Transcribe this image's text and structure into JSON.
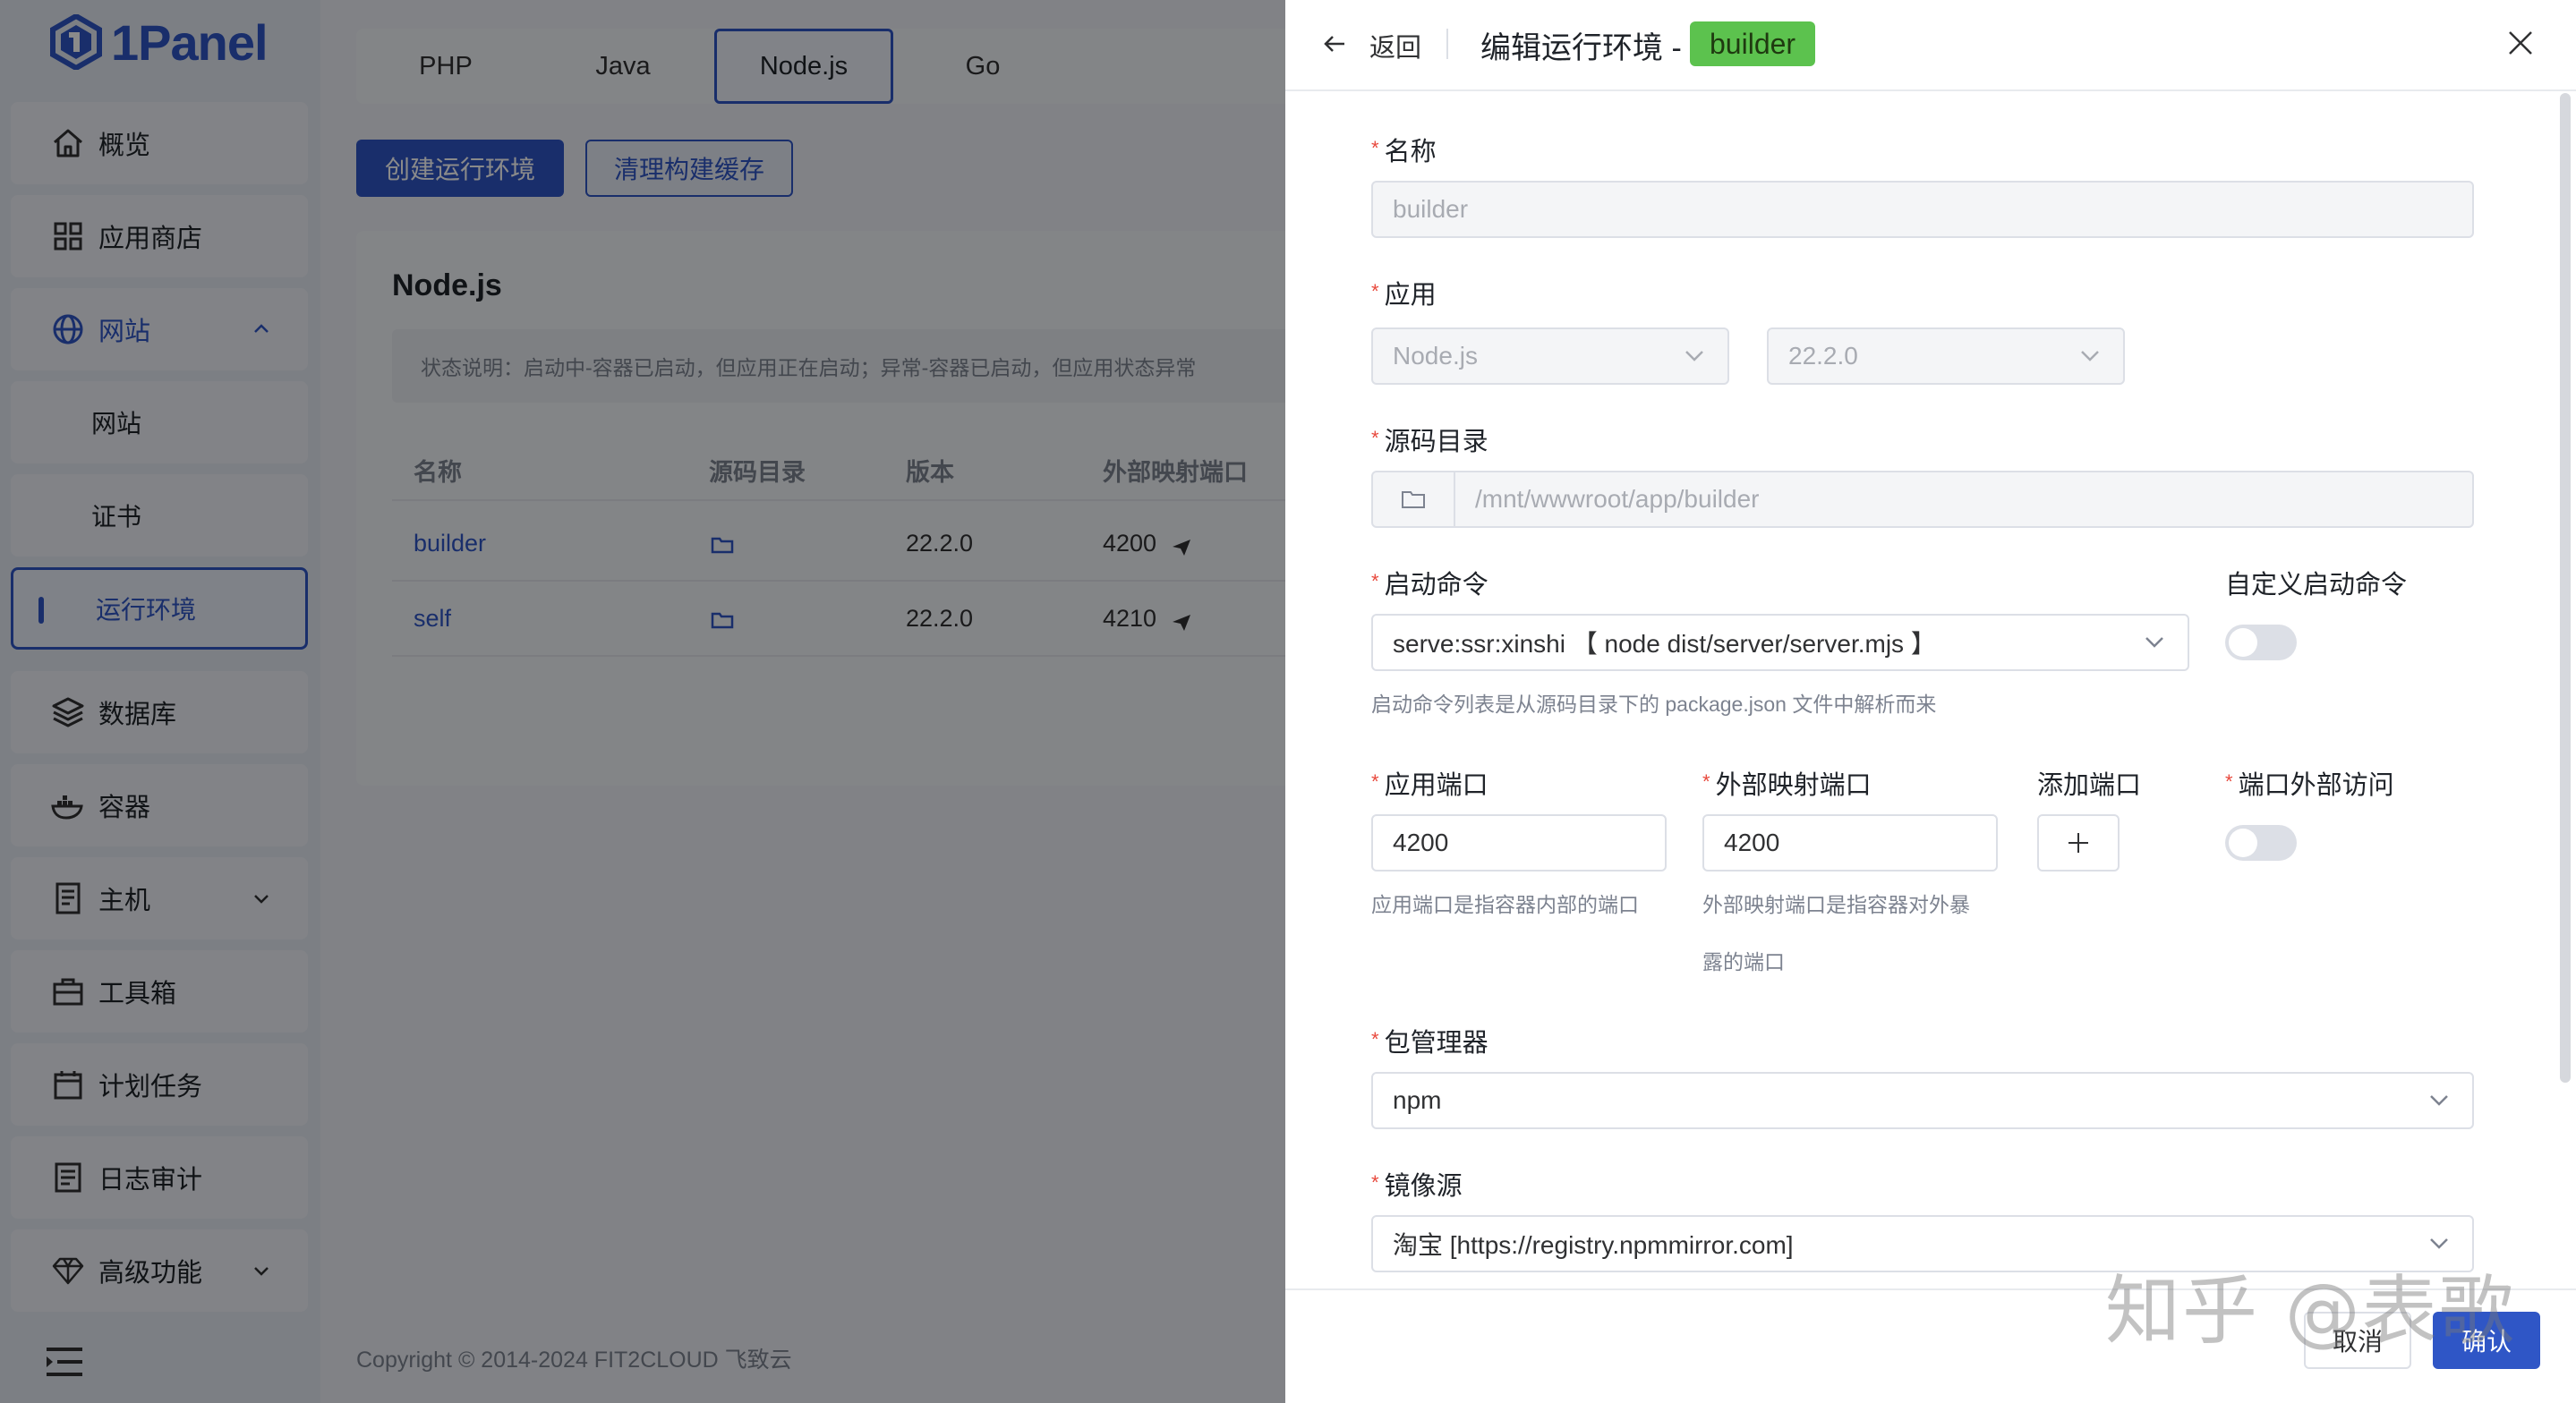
{
  "app": {
    "logo_text": "1Panel"
  },
  "sidebar": {
    "items": [
      {
        "label": "概览",
        "icon": "home-icon"
      },
      {
        "label": "应用商店",
        "icon": "grid-icon"
      },
      {
        "label": "网站",
        "icon": "globe-icon",
        "expanded": true
      },
      {
        "label": "网站",
        "sub": true
      },
      {
        "label": "证书",
        "sub": true
      },
      {
        "label": "运行环境",
        "sub": true,
        "active": true
      },
      {
        "label": "数据库",
        "icon": "layers-icon"
      },
      {
        "label": "容器",
        "icon": "docker-icon"
      },
      {
        "label": "主机",
        "icon": "host-icon",
        "collapsible": true
      },
      {
        "label": "工具箱",
        "icon": "toolbox-icon"
      },
      {
        "label": "计划任务",
        "icon": "calendar-icon"
      },
      {
        "label": "日志审计",
        "icon": "log-icon"
      },
      {
        "label": "高级功能",
        "icon": "diamond-icon",
        "collapsible": true
      }
    ]
  },
  "main": {
    "tabs": [
      "PHP",
      "Java",
      "Node.js",
      "Go"
    ],
    "active_tab": "Node.js",
    "create_button": "创建运行环境",
    "clean_button": "清理构建缓存",
    "card_title": "Node.js",
    "status_note": "状态说明：启动中-容器已启动，但应用正在启动；异常-容器已启动，但应用状态异常",
    "table": {
      "headers": [
        "名称",
        "源码目录",
        "版本",
        "外部映射端口"
      ],
      "rows": [
        {
          "name": "builder",
          "version": "22.2.0",
          "port": "4200"
        },
        {
          "name": "self",
          "version": "22.2.0",
          "port": "4210"
        }
      ]
    },
    "footer": "Copyright © 2014-2024 FIT2CLOUD 飞致云"
  },
  "drawer": {
    "back_label": "返回",
    "title": "编辑运行环境 -",
    "badge": "builder",
    "fields": {
      "name_label": "名称",
      "name_value": "builder",
      "app_label": "应用",
      "app_value": "Node.js",
      "version_value": "22.2.0",
      "source_label": "源码目录",
      "source_value": "/mnt/wwwroot/app/builder",
      "cmd_label": "启动命令",
      "cmd_value": "serve:ssr:xinshi 【 node dist/server/server.mjs 】",
      "cmd_help": "启动命令列表是从源码目录下的 package.json 文件中解析而来",
      "custom_cmd_label": "自定义启动命令",
      "custom_cmd_enabled": false,
      "app_port_label": "应用端口",
      "app_port_value": "4200",
      "app_port_help": "应用端口是指容器内部的端口",
      "ext_port_label": "外部映射端口",
      "ext_port_value": "4200",
      "ext_port_help_1": "外部映射端口是指容器对外暴",
      "ext_port_help_2": "露的端口",
      "add_port_label": "添加端口",
      "port_access_label": "端口外部访问",
      "port_access_enabled": false,
      "pkg_label": "包管理器",
      "pkg_value": "npm",
      "mirror_label": "镜像源",
      "mirror_value": "淘宝 [https://registry.npmmirror.com]"
    },
    "cancel": "取消",
    "confirm": "确认"
  },
  "watermark": "知乎 @表歌",
  "colors": {
    "accent": "#2f56c6",
    "badge": "#5cc24e",
    "required": "#e8483c"
  }
}
